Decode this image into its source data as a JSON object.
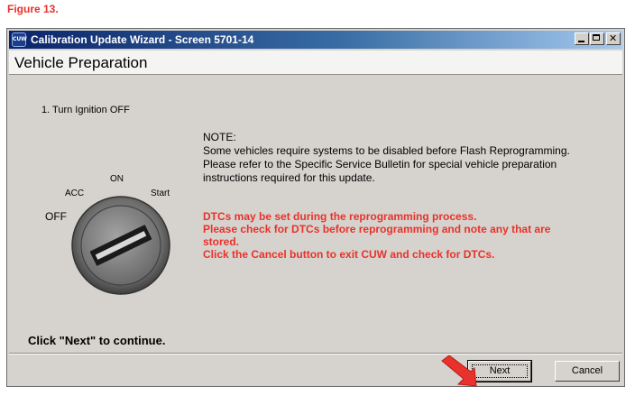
{
  "figure_label": "Figure 13.",
  "window": {
    "title": "Calibration Update Wizard - Screen 5701-14",
    "app_icon_text": "CUW",
    "icons": [
      "cuw-app-icon",
      "minimize-icon",
      "maximize-icon",
      "close-icon"
    ]
  },
  "header": {
    "title": "Vehicle Preparation"
  },
  "step": {
    "text": "1. Turn Ignition OFF"
  },
  "note": {
    "lines": [
      "NOTE:",
      "Some vehicles require systems to be disabled before Flash Reprogramming.",
      "Please refer to the Specific Service Bulletin for special vehicle preparation",
      "instructions required for this update."
    ]
  },
  "warning": {
    "color": "#e8322b",
    "lines": [
      "DTCs may be set during the reprogramming process.",
      "Please check for DTCs before reprogramming and note any that are",
      "stored.",
      "Click the Cancel button to exit CUW and check for DTCs."
    ]
  },
  "ignition": {
    "labels": {
      "on": "ON",
      "acc": "ACC",
      "start": "Start",
      "off": "OFF"
    },
    "icon": "ignition-key-icon"
  },
  "footer": {
    "continue_text": "Click \"Next\" to continue.",
    "next_label": "Next",
    "cancel_label": "Cancel"
  },
  "annotation": {
    "icon": "red-arrow-icon",
    "color": "#e8322b"
  }
}
